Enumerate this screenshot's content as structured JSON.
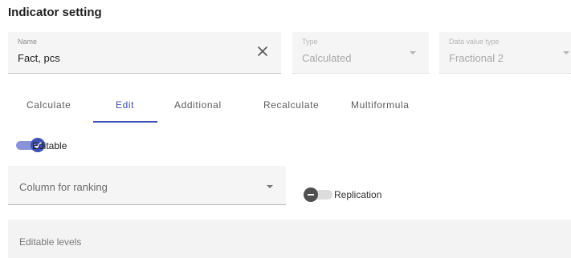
{
  "page": {
    "title": "Indicator setting"
  },
  "fields": {
    "name": {
      "label": "Name",
      "value": "Fact, pcs"
    },
    "type": {
      "label": "Type",
      "value": "Calculated"
    },
    "data_value_type": {
      "label": "Data value type",
      "value": "Fractional 2"
    }
  },
  "tabs": [
    {
      "label": "Calculate"
    },
    {
      "label": "Edit",
      "active": true
    },
    {
      "label": "Additional"
    },
    {
      "label": "Recalculate"
    },
    {
      "label": "Multiformula"
    }
  ],
  "edit": {
    "editable": {
      "label": "Editable",
      "checked": true
    },
    "column_for_ranking": {
      "placeholder": "Column for ranking"
    },
    "replication": {
      "label": "Replication",
      "checked": false
    },
    "editable_levels": {
      "placeholder": "Editable levels"
    }
  },
  "colors": {
    "accent": "#3f51b5",
    "field_bg": "#f5f5f5"
  },
  "icons": {
    "clear": "close-icon",
    "dropdown": "chevron-down-icon",
    "check": "check-icon",
    "minus": "minus-icon"
  }
}
